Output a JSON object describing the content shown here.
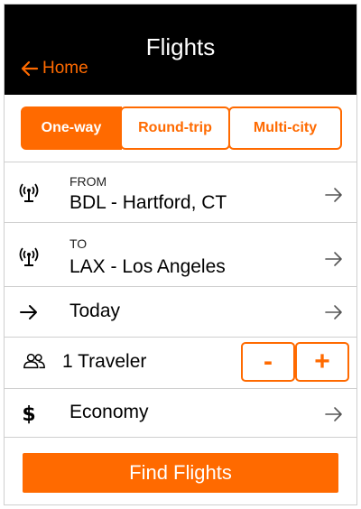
{
  "header": {
    "title": "Flights",
    "back_label": "Home"
  },
  "trip_types": [
    {
      "label": "One-way",
      "active": true
    },
    {
      "label": "Round-trip",
      "active": false
    },
    {
      "label": "Multi-city",
      "active": false
    }
  ],
  "from": {
    "label": "FROM",
    "value": "BDL - Hartford, CT",
    "icon": "antenna-icon"
  },
  "to": {
    "label": "TO",
    "value": "LAX - Los Angeles",
    "icon": "antenna-icon"
  },
  "date": {
    "value": "Today",
    "icon": "arrow-right-icon"
  },
  "travelers": {
    "value": "1 Traveler",
    "icon": "people-icon",
    "minus_label": "-",
    "plus_label": "+"
  },
  "cabin_class": {
    "value": "Economy",
    "icon": "dollar-icon"
  },
  "find_button": {
    "label": "Find Flights"
  },
  "colors": {
    "accent": "#ff6a00",
    "header_bg": "#000000",
    "divider": "#cfcfcf"
  }
}
